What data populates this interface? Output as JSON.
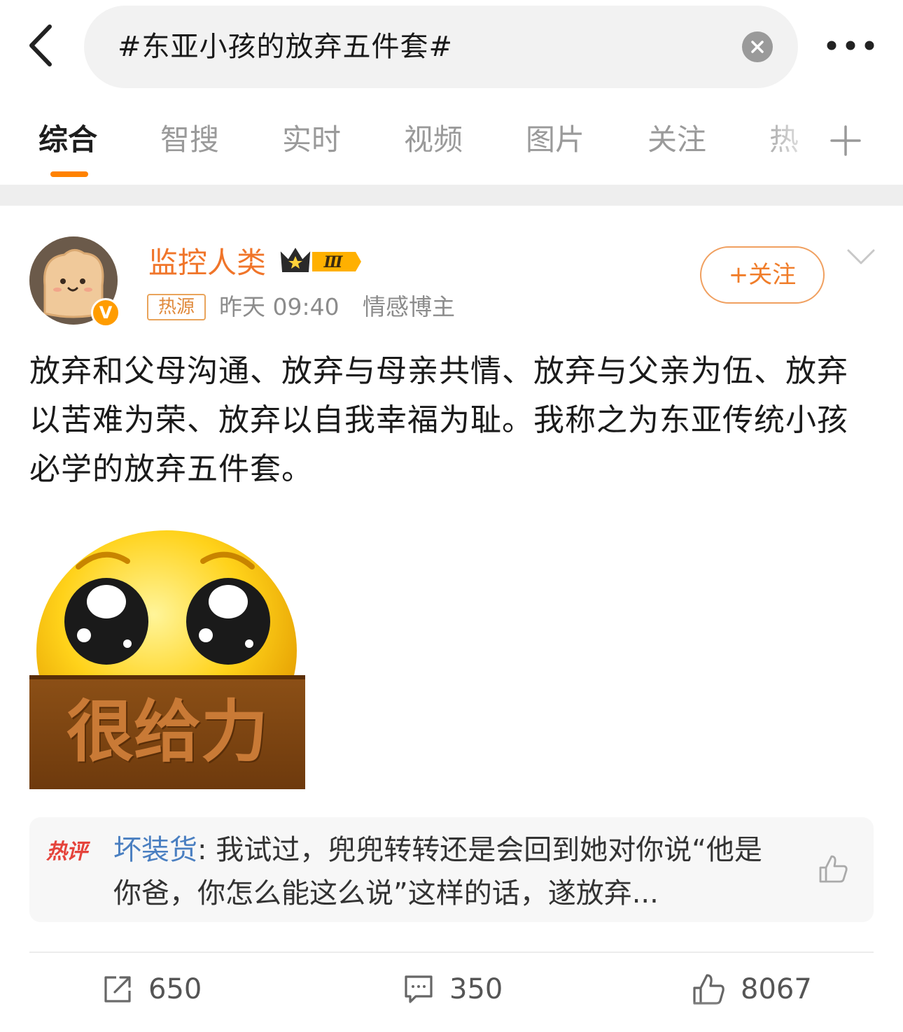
{
  "search": {
    "query": "#东亚小孩的放弃五件套#"
  },
  "tabs": [
    {
      "label": "综合",
      "active": true
    },
    {
      "label": "智搜",
      "active": false
    },
    {
      "label": "实时",
      "active": false
    },
    {
      "label": "视频",
      "active": false
    },
    {
      "label": "图片",
      "active": false
    },
    {
      "label": "关注",
      "active": false
    },
    {
      "label": "热",
      "active": false
    }
  ],
  "post": {
    "author": {
      "name": "监控人类",
      "vip_level": "Ⅲ",
      "verified_badge": "V"
    },
    "source_tag": "热源",
    "time": "昨天 09:40",
    "role": "情感博主",
    "follow_label": "+关注",
    "text": "放弃和父母沟通、放弃与母亲共情、放弃与父亲为伍、放弃以苦难为荣、放弃以自我幸福为耻。我称之为东亚传统小孩必学的放弃五件套。",
    "image_caption": "很给力",
    "hot_comment": {
      "label": "热评",
      "author": "坏装货",
      "text": ": 我试过，兜兜转转还是会回到她对你说“他是你爸，你怎么能这么说”这样的话，遂放弃..."
    },
    "actions": {
      "reposts": "650",
      "comments": "350",
      "likes": "8067"
    }
  },
  "colors": {
    "accent_orange": "#ff8200",
    "username": "#f0752a",
    "comment_author": "#4a7fc1",
    "hot_label": "#e5433b"
  }
}
